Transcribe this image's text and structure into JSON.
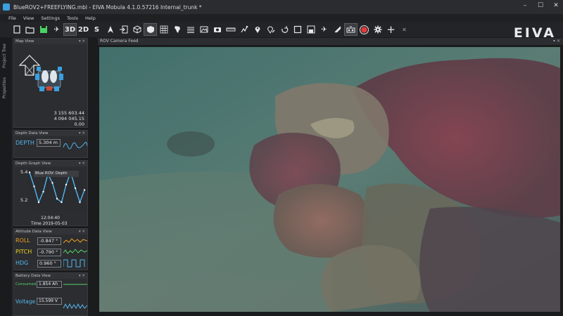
{
  "window": {
    "title": "BlueROV2+FREEFLYING.mbl - EIVA Mobula 4.1.0.57216 Internal_trunk *",
    "controls": [
      "–",
      "☐",
      "✕"
    ]
  },
  "menu": [
    "File",
    "View",
    "Settings",
    "Tools",
    "Help"
  ],
  "toolbar": {
    "labels": {
      "3d": "3D",
      "2d": "2D",
      "s": "S"
    },
    "glyphs": {
      "new": "▭",
      "open": "📂",
      "save": "💾",
      "plane": "✈",
      "arrow": "⮝",
      "import": "⇥",
      "cube": "⬡",
      "layers": "◈",
      "grid": "▦",
      "africa": "◭",
      "lines": "☰",
      "image": "▣",
      "camera": "◙",
      "ruler": "▬",
      "track": "⤳",
      "pin": "⚲",
      "pin-off": "⚲",
      "undo": "↺",
      "square": "▢",
      "disk": "🖫",
      "plane2": "✈",
      "drone": "✎",
      "rov": "▣",
      "record": "●",
      "gear": "✹",
      "plus": "+",
      "close": "✕"
    }
  },
  "logo": "EIVA",
  "vertical_tabs": [
    "Project Tree",
    "Properties"
  ],
  "map_view": {
    "title": "Map View",
    "coords": [
      "3 155 603.44",
      "4 094 045.15",
      "0.00"
    ]
  },
  "depth_view": {
    "title": "Depth Data View",
    "label": "DEPTH",
    "value": "5.304 m"
  },
  "depth_graph": {
    "title": "Depth Graph View",
    "y_top": "5.4",
    "y_bottom": "5.2",
    "legend": "Blue ROV: Depth",
    "time": "12:04:40",
    "date": "Time 2019-05-03",
    "series_color": "#56b5ee",
    "samples": [
      5.39,
      5.31,
      5.22,
      5.28,
      5.38,
      5.33,
      5.24,
      5.22,
      5.32,
      5.39,
      5.3,
      5.22,
      5.29
    ]
  },
  "attitude_view": {
    "title": "Attitude Data View",
    "rows": [
      {
        "label": "ROLL",
        "value": "-0.847 °",
        "color": "#f0a020"
      },
      {
        "label": "PITCH",
        "value": "-0.790 °",
        "color": "#f0d020"
      },
      {
        "label": "HDG",
        "value": "0.960 °",
        "color": "#56b5ee"
      }
    ]
  },
  "battery_view": {
    "title": "Battery Data View",
    "rows": [
      {
        "label": "Consumed",
        "value": "1.854 Ah"
      },
      {
        "label": "Voltage",
        "value": "15.599 V"
      }
    ]
  },
  "camera": {
    "title": "ROV Camera Feed"
  }
}
